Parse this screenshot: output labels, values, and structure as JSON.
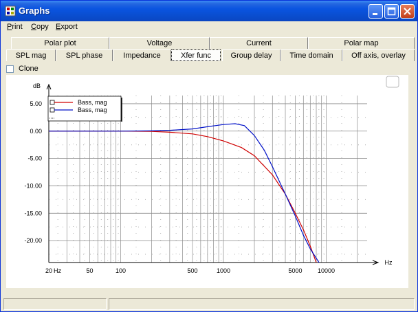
{
  "window": {
    "title": "Graphs"
  },
  "menu": [
    "Print",
    "Copy",
    "Export"
  ],
  "tabs_row1": [
    "Polar plot",
    "Voltage",
    "Current",
    "Polar map"
  ],
  "tabs_row2": [
    "SPL mag",
    "SPL phase",
    "Impedance",
    "Xfer func",
    "Group delay",
    "Time domain",
    "Off axis, overlay"
  ],
  "selected_tab": "Xfer func",
  "clone": {
    "label": "Clone",
    "checked": false
  },
  "chart_data": {
    "type": "line",
    "ylabel": "dB",
    "xlabel": "Hz",
    "xscale": "log",
    "xlim": [
      20,
      25000
    ],
    "ylim": [
      -24,
      6.5
    ],
    "x_ticks": [
      "20",
      "50",
      "100",
      "500",
      "1000",
      "5000",
      "10000"
    ],
    "y_ticks": [
      "5.00",
      "0.00",
      "-5.00",
      "-10.00",
      "-15.00",
      "-20.00"
    ],
    "grid": true,
    "legend": "top-left",
    "series": [
      {
        "name": "Bass, mag",
        "color": "#d00000",
        "x": [
          20,
          100,
          200,
          300,
          500,
          700,
          1000,
          1500,
          2000,
          3000,
          4000,
          5000,
          6000,
          7000,
          8000
        ],
        "values": [
          0,
          0,
          -0.05,
          -0.2,
          -0.5,
          -1.0,
          -1.8,
          -3.0,
          -4.5,
          -8.0,
          -11.5,
          -15.0,
          -18.0,
          -21.0,
          -24.0
        ]
      },
      {
        "name": "Bass, mag",
        "color": "#0010c8",
        "x": [
          20,
          100,
          200,
          300,
          500,
          700,
          1000,
          1300,
          1600,
          2000,
          2500,
          3000,
          4000,
          5000,
          6000,
          7000,
          8500
        ],
        "values": [
          0,
          0,
          0.05,
          0.15,
          0.4,
          0.8,
          1.2,
          1.35,
          1.0,
          -0.8,
          -3.5,
          -6.5,
          -11.5,
          -15.5,
          -19.0,
          -21.5,
          -24.0
        ]
      }
    ]
  }
}
